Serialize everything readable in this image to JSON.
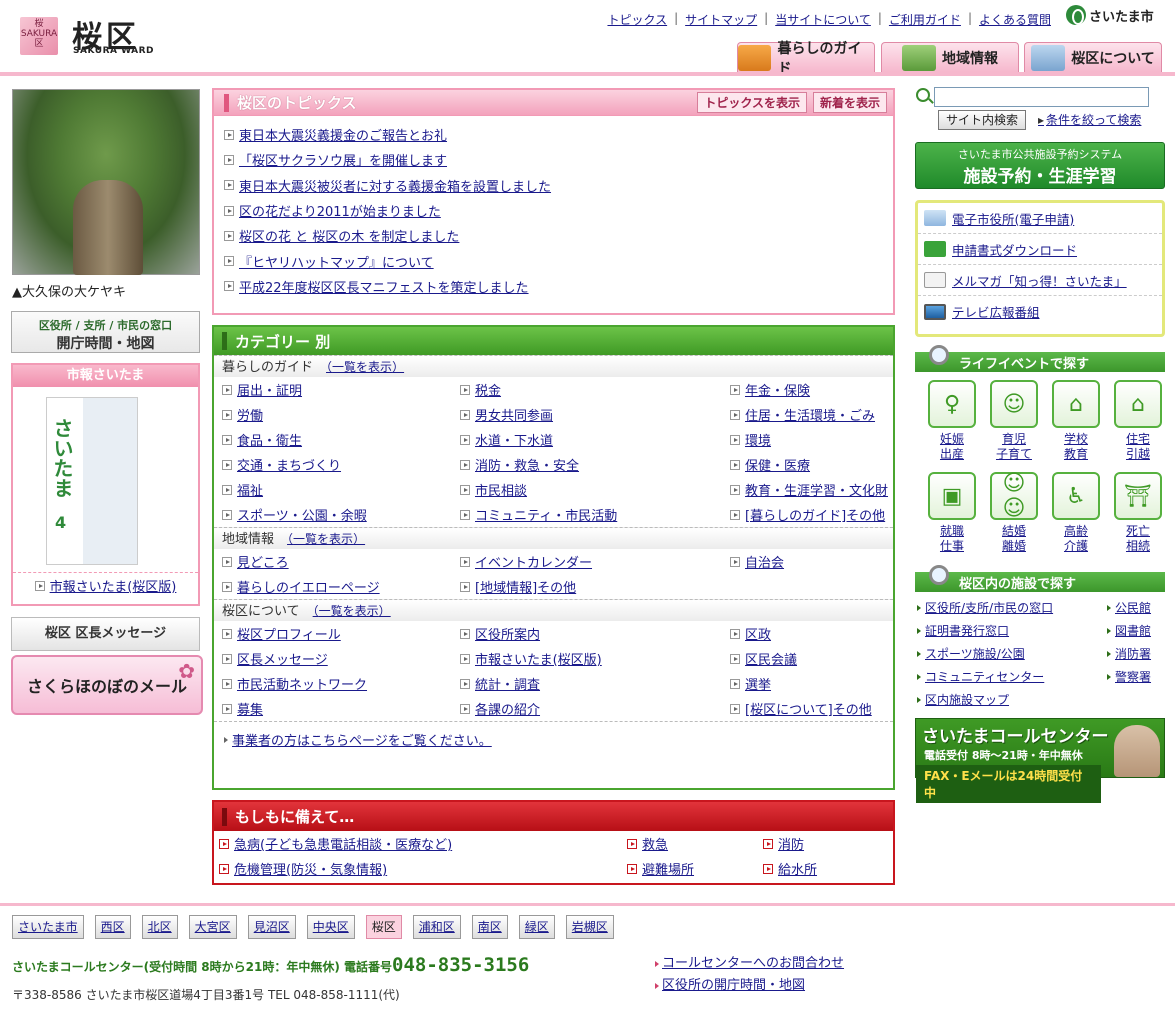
{
  "header": {
    "logo_badge": "桜 SAKURA 区",
    "title": "桜区",
    "subtitle": "SAKURA WARD",
    "top_links": [
      "トピックス",
      "サイトマップ",
      "当サイトについて",
      "ご利用ガイド",
      "よくある質問"
    ],
    "city_logo": "さいたま市",
    "nav_tabs": [
      "暮らしのガイド",
      "地域情報",
      "桜区について"
    ],
    "accent_color": "#f6b8cd"
  },
  "left": {
    "photo_caption": "▲大久保の大ケヤキ",
    "hours_small": "区役所 / 支所 / 市民の窓口",
    "hours_big": "開庁時間・地図",
    "shiho_title": "市報さいたま",
    "shiho_cover_title": "さいたま",
    "shiho_cover_num": "4",
    "shiho_link": "市報さいたま(桜区版)",
    "message_label": "桜区 区長メッセージ",
    "mail_banner": "さくらほのぼのメール"
  },
  "topics": {
    "title": "桜区のトピックス",
    "btn_show": "トピックスを表示",
    "btn_new": "新着を表示",
    "items": [
      "東日本大震災義援金のご報告とお礼",
      "「桜区サクラソウ展」を開催します",
      "東日本大震災被災者に対する義援金箱を設置しました",
      "区の花だより2011が始まりました",
      "桜区の花 と 桜区の木 を制定しました",
      "『ヒヤリハットマップ』について",
      "平成22年度桜区区長マニフェストを策定しました"
    ]
  },
  "category": {
    "title": "カテゴリー 別",
    "list_link": "一覧を表示",
    "sections": [
      {
        "name": "暮らしのガイド",
        "items": [
          "届出・証明",
          "税金",
          "年金・保険",
          "労働",
          "男女共同参画",
          "住居・生活環境・ごみ",
          "食品・衛生",
          "水道・下水道",
          "環境",
          "交通・まちづくり",
          "消防・救急・安全",
          "保健・医療",
          "福祉",
          "市民相談",
          "教育・生涯学習・文化財",
          "スポーツ・公園・余暇",
          "コミュニティ・市民活動",
          "[暮らしのガイド]その他"
        ]
      },
      {
        "name": "地域情報",
        "items": [
          "見どころ",
          "イベントカレンダー",
          "自治会",
          "暮らしのイエローページ",
          "[地域情報]その他"
        ]
      },
      {
        "name": "桜区について",
        "items": [
          "桜区プロフィール",
          "区役所案内",
          "区政",
          "区長メッセージ",
          "市報さいたま(桜区版)",
          "区民会議",
          "市民活動ネットワーク",
          "統計・調査",
          "選挙",
          "募集",
          "各課の紹介",
          "[桜区について]その他"
        ]
      }
    ],
    "business_link": "事業者の方はこちらページをご覧ください。"
  },
  "emergency": {
    "title": "もしもに備えて…",
    "items": [
      "急病(子ども急患電話相談・医療など)",
      "救急",
      "消防",
      "危機管理(防災・気象情報)",
      "避難場所",
      "給水所"
    ]
  },
  "right": {
    "search_placeholder": "",
    "search_button": "サイト内検索",
    "advanced_link": "条件を絞って検索",
    "reserve_small": "さいたま市公共施設予約システム",
    "reserve_big": "施設予約・生涯学習",
    "eservices": [
      "電子市役所(電子申請)",
      "申請書式ダウンロード",
      "メルマガ「知っ得！さいたま」",
      "テレビ広報番組"
    ],
    "life_title": "ライフイベントで探す",
    "life_events": [
      {
        "l1": "妊娠",
        "l2": "出産",
        "icon": "pregnancy-icon"
      },
      {
        "l1": "育児",
        "l2": "子育て",
        "icon": "child-icon"
      },
      {
        "l1": "学校",
        "l2": "教育",
        "icon": "school-icon"
      },
      {
        "l1": "住宅",
        "l2": "引越",
        "icon": "house-icon"
      },
      {
        "l1": "就職",
        "l2": "仕事",
        "icon": "briefcase-icon"
      },
      {
        "l1": "結婚",
        "l2": "離婚",
        "icon": "couple-icon"
      },
      {
        "l1": "高齢",
        "l2": "介護",
        "icon": "elderly-icon"
      },
      {
        "l1": "死亡",
        "l2": "相続",
        "icon": "memorial-icon"
      }
    ],
    "facility_title": "桜区内の施設で探す",
    "facilities": [
      "区役所/支所/市民の窓口",
      "公民館",
      "証明書発行窓口",
      "図書館",
      "スポーツ施設/公園",
      "消防署",
      "コミュニティセンター",
      "警察署",
      "区内施設マップ"
    ],
    "callcenter_title": "さいたまコールセンター",
    "callcenter_hours": "電話受付 8時～21時・年中無休",
    "callcenter_fax": "FAX・Eメールは24時間受付中"
  },
  "footer": {
    "wards": [
      "さいたま市",
      "西区",
      "北区",
      "大宮区",
      "見沼区",
      "中央区",
      "桜区",
      "浦和区",
      "南区",
      "緑区",
      "岩槻区"
    ],
    "current_ward": "桜区",
    "cc_text": "さいたまコールセンター(受付時間 8時から21時：年中無休) 電話番号",
    "cc_number": "048-835-3156",
    "address": "〒338-8586 さいたま市桜区道場4丁目3番1号 TEL 048-858-1111(代)",
    "links": [
      "コールセンターへのお問合わせ",
      "区役所の開庁時間・地図"
    ]
  }
}
